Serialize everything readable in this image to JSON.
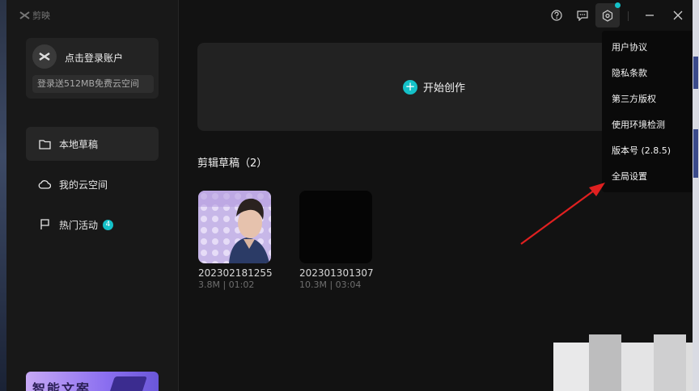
{
  "app": {
    "logo_text": "剪映"
  },
  "sidebar": {
    "login_title": "点击登录账户",
    "login_subtitle": "登录送512MB免费云空间",
    "nav": [
      {
        "label": "本地草稿",
        "icon": "folder-icon",
        "active": true
      },
      {
        "label": "我的云空间",
        "icon": "cloud-icon",
        "active": false
      },
      {
        "label": "热门活动",
        "icon": "flag-icon",
        "active": false,
        "badge": "4"
      }
    ],
    "promo_text": "智能文案"
  },
  "toolbar": {
    "icons": [
      "help-icon",
      "feedback-icon",
      "settings-icon",
      "minimize-icon",
      "close-icon"
    ]
  },
  "main": {
    "create_label": "开始创作",
    "drafts_title": "剪辑草稿（2）",
    "drafts": [
      {
        "name": "202302181255",
        "meta": "3.8M | 01:02"
      },
      {
        "name": "202301301307",
        "meta": "10.3M | 03:04"
      }
    ]
  },
  "settings_menu": {
    "items": [
      "用户协议",
      "隐私条款",
      "第三方版权",
      "使用环境检测",
      "版本号 (2.8.5)",
      "全局设置"
    ]
  },
  "colors": {
    "accent": "#14c1c8",
    "annotation_arrow": "#e02020"
  }
}
